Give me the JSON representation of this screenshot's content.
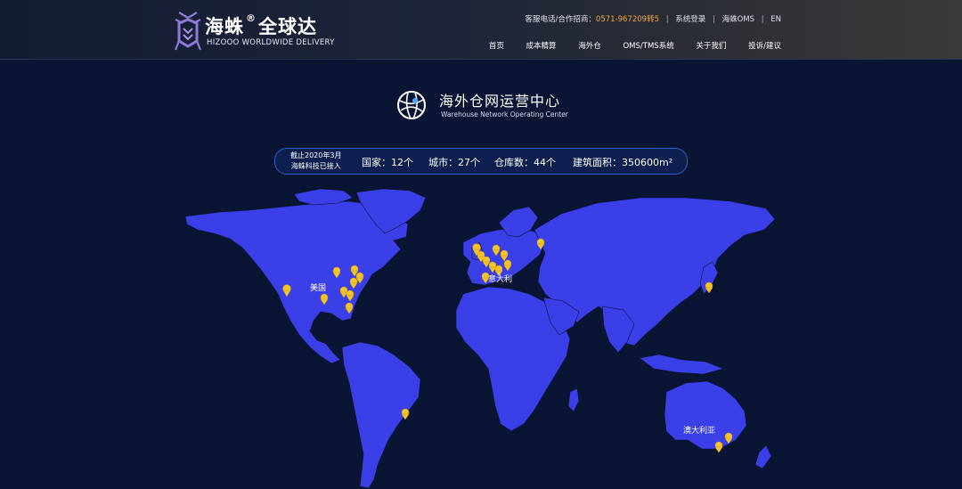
{
  "brand": {
    "name_cn_1": "海蛛",
    "reg": "®",
    "name_cn_2": "全球达",
    "name_en": "HIZOOO WORLDWIDE DELIVERY"
  },
  "topbar": {
    "hotline_label": "客服电话/合作招商：",
    "hotline": "0571-967209转5",
    "login": "系统登录",
    "oms": "海蛛OMS",
    "lang": "EN"
  },
  "nav": [
    {
      "label": "首页"
    },
    {
      "label": "成本精算"
    },
    {
      "label": "海外仓"
    },
    {
      "label": "OMS/TMS系统"
    },
    {
      "label": "关于我们"
    },
    {
      "label": "投诉/建议"
    }
  ],
  "section": {
    "title": "海外仓网运营中心",
    "subtitle": "Warehouse Network Operating Center"
  },
  "stats": {
    "date_line1": "截止2020年3月",
    "date_line2": "海蛛科技已接入",
    "countries": "国家：12个",
    "cities": "城市：27个",
    "warehouses": "仓库数：44个",
    "area": "建筑面积：350600m²"
  },
  "map": {
    "land_color": "#3a3fe8",
    "ocean_color": "#0a1433",
    "pin_color": "#f5c52b",
    "labels": {
      "usa": "美国",
      "italy": "意大利",
      "australia": "澳大利亚"
    }
  }
}
